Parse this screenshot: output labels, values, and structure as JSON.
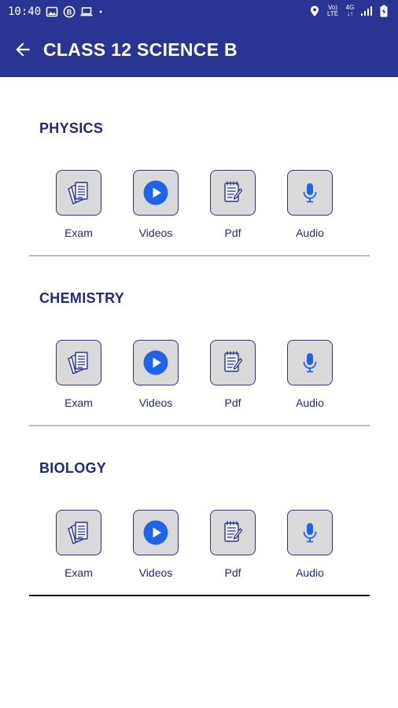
{
  "status_bar": {
    "time": "10:40",
    "left_icons": [
      "image-icon",
      "b-badge-icon",
      "laptop-icon",
      "dot-icon"
    ],
    "right_icons": [
      "location-icon",
      "volte-lte-icon",
      "4g-signal-icon",
      "signal-bars-icon",
      "battery-charging-icon"
    ],
    "volte_line1": "Vo)",
    "volte_line2": "LTE",
    "net_line1": "4G",
    "net_line2": "↓↑"
  },
  "app_bar": {
    "title": "CLASS 12 SCIENCE B",
    "back_icon": "arrow-left-icon",
    "background": "#2a3593"
  },
  "sections": [
    {
      "title": "PHYSICS",
      "items": [
        {
          "label": "Exam",
          "icon": "documents-stack-icon"
        },
        {
          "label": "Videos",
          "icon": "play-circle-icon"
        },
        {
          "label": "Pdf",
          "icon": "notepad-pen-icon"
        },
        {
          "label": "Audio",
          "icon": "microphone-icon"
        }
      ]
    },
    {
      "title": "CHEMISTRY",
      "items": [
        {
          "label": "Exam",
          "icon": "documents-stack-icon"
        },
        {
          "label": "Videos",
          "icon": "play-circle-icon"
        },
        {
          "label": "Pdf",
          "icon": "notepad-pen-icon"
        },
        {
          "label": "Audio",
          "icon": "microphone-icon"
        }
      ]
    },
    {
      "title": "BIOLOGY",
      "items": [
        {
          "label": "Exam",
          "icon": "documents-stack-icon"
        },
        {
          "label": "Videos",
          "icon": "play-circle-icon"
        },
        {
          "label": "Pdf",
          "icon": "notepad-pen-icon"
        },
        {
          "label": "Audio",
          "icon": "microphone-icon"
        }
      ]
    }
  ],
  "colors": {
    "primary": "#2a3593",
    "title_text": "#1f2a80",
    "tile_fill": "#d9d9d9",
    "icon_blue": "#1e63e9"
  }
}
